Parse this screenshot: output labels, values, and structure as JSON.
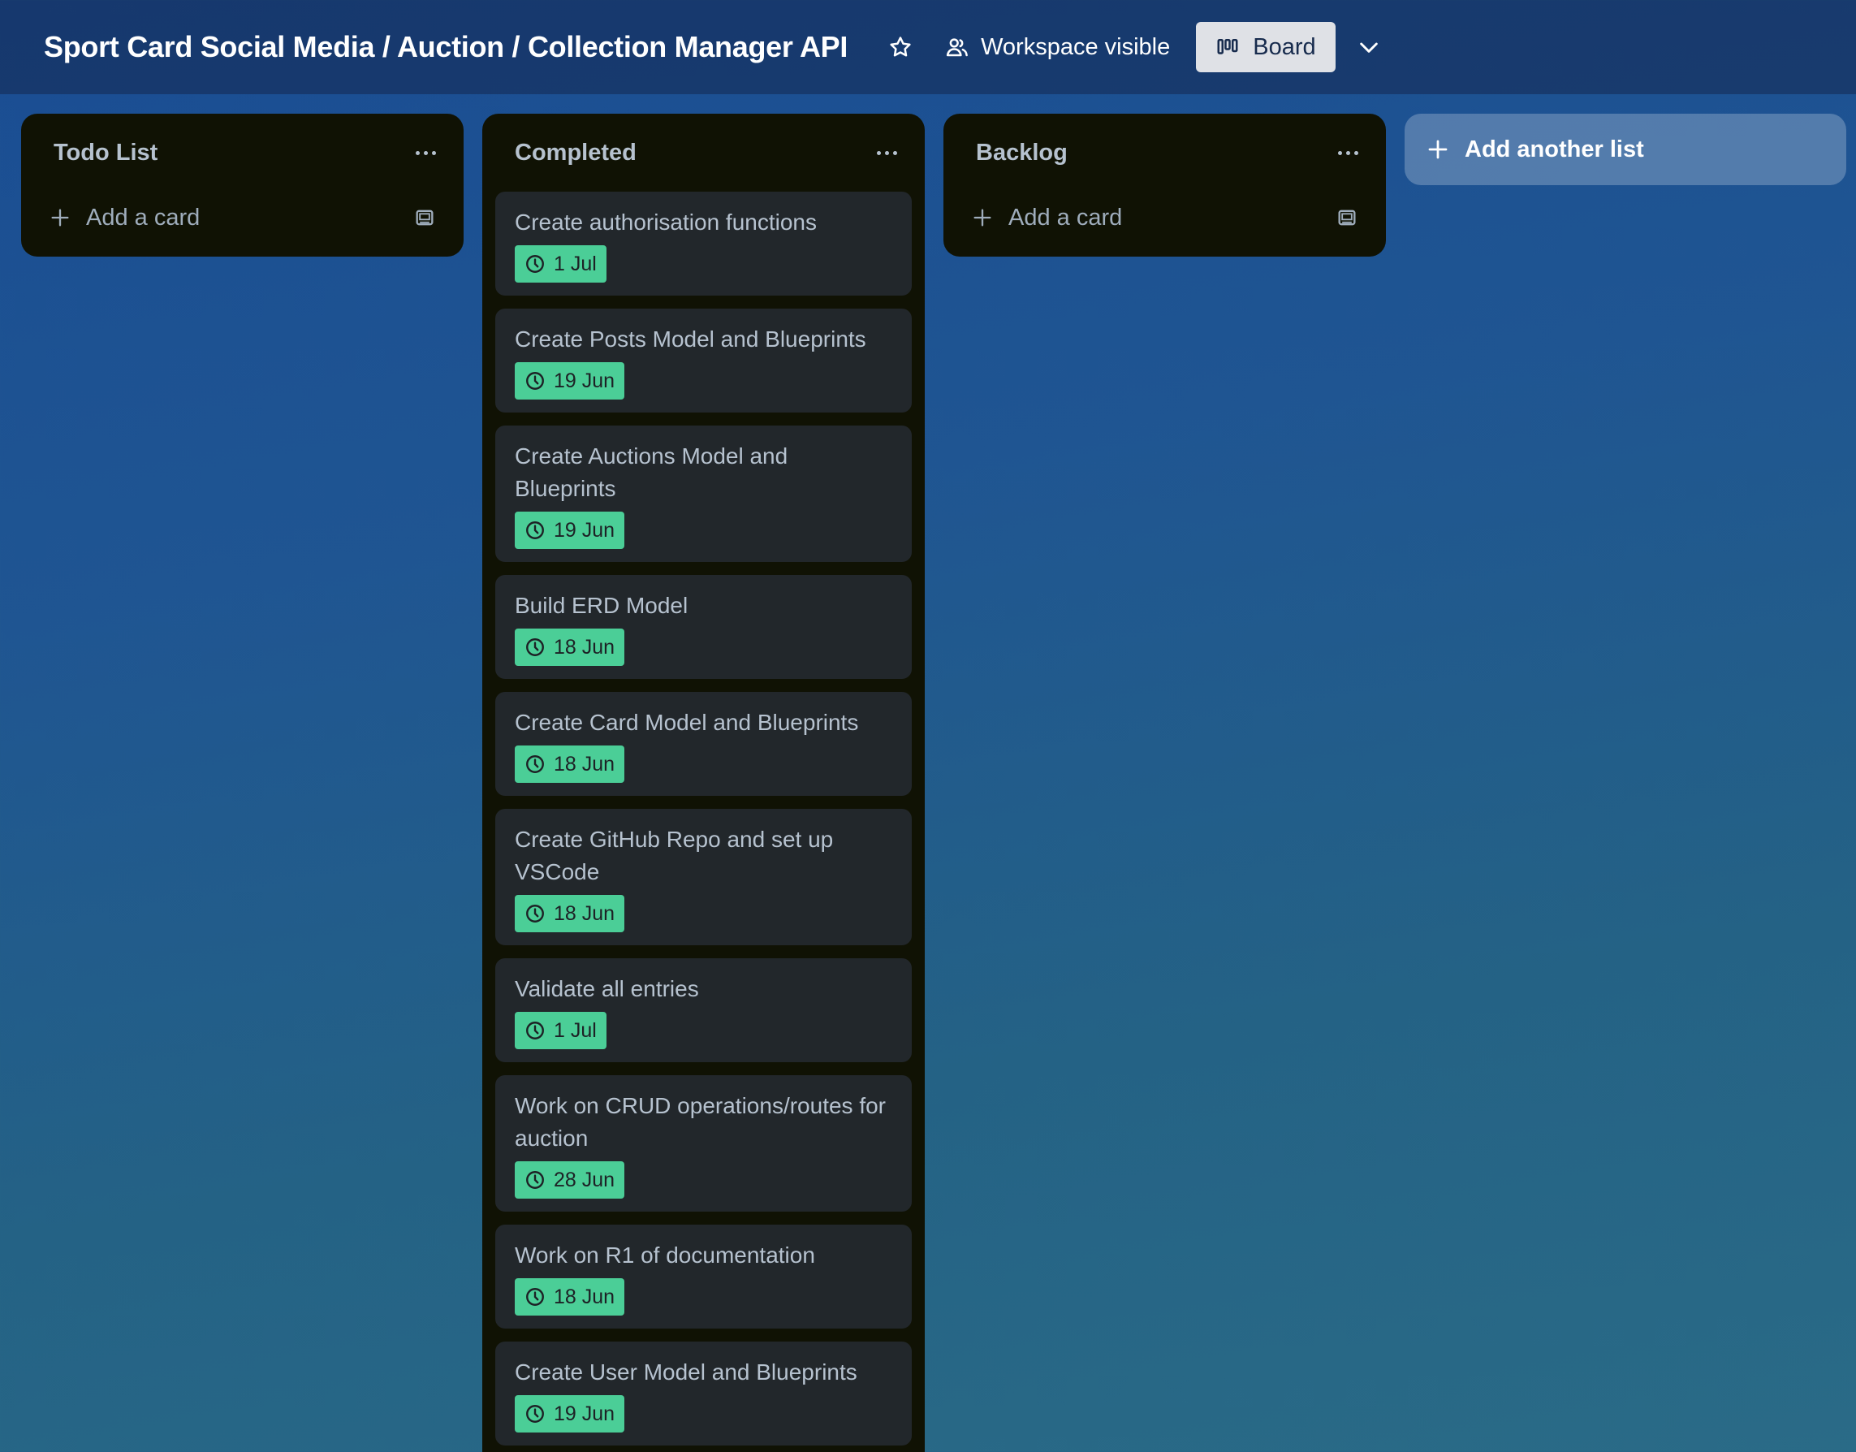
{
  "header": {
    "board_title": "Sport Card Social Media / Auction / Collection Manager API",
    "visibility_label": "Workspace visible",
    "view_label": "Board"
  },
  "lists": [
    {
      "title": "Todo List",
      "add_card_label": "Add a card",
      "cards": []
    },
    {
      "title": "Completed",
      "cards": [
        {
          "title": "Create authorisation functions",
          "due": "1 Jul"
        },
        {
          "title": "Create Posts Model and Blueprints",
          "due": "19 Jun"
        },
        {
          "title": "Create Auctions Model and Blueprints",
          "due": "19 Jun"
        },
        {
          "title": "Build ERD Model",
          "due": "18 Jun"
        },
        {
          "title": "Create Card Model and Blueprints",
          "due": "18 Jun"
        },
        {
          "title": "Create GitHub Repo and set up VSCode",
          "due": "18 Jun"
        },
        {
          "title": "Validate all entries",
          "due": "1 Jul"
        },
        {
          "title": "Work on CRUD operations/routes for auction",
          "due": "28 Jun"
        },
        {
          "title": "Work on R1 of documentation",
          "due": "18 Jun"
        },
        {
          "title": "Create User Model and Blueprints",
          "due": "19 Jun"
        }
      ]
    },
    {
      "title": "Backlog",
      "add_card_label": "Add a card",
      "cards": []
    }
  ],
  "add_list_label": "Add another list",
  "colors": {
    "due_badge_bg": "#4bce97",
    "list_bg": "#101204",
    "card_bg": "#22272b"
  }
}
